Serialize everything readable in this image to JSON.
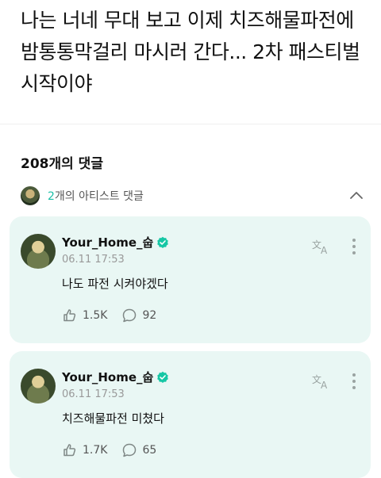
{
  "post": {
    "text": "나는 너네 무대 보고 이제 치즈해물파전에 밤통통막걸리 마시러 간다... 2차 패스티벌 시작이야"
  },
  "comments_section": {
    "count_label": "208개의 댓글",
    "artist_comments": {
      "count": "2",
      "label": "개의 아티스트 댓글"
    }
  },
  "comments": [
    {
      "author": "Your_Home_숩",
      "time": "06.11 17:53",
      "text": "나도 파전 시켜야겠다",
      "likes": "1.5K",
      "replies": "92"
    },
    {
      "author": "Your_Home_숩",
      "time": "06.11 17:53",
      "text": "치즈해물파전 미쳤다",
      "likes": "1.7K",
      "replies": "65"
    }
  ],
  "colors": {
    "accent": "#1bbfa7",
    "card_bg": "#e9f7f4",
    "verified": "#16c7a5"
  }
}
